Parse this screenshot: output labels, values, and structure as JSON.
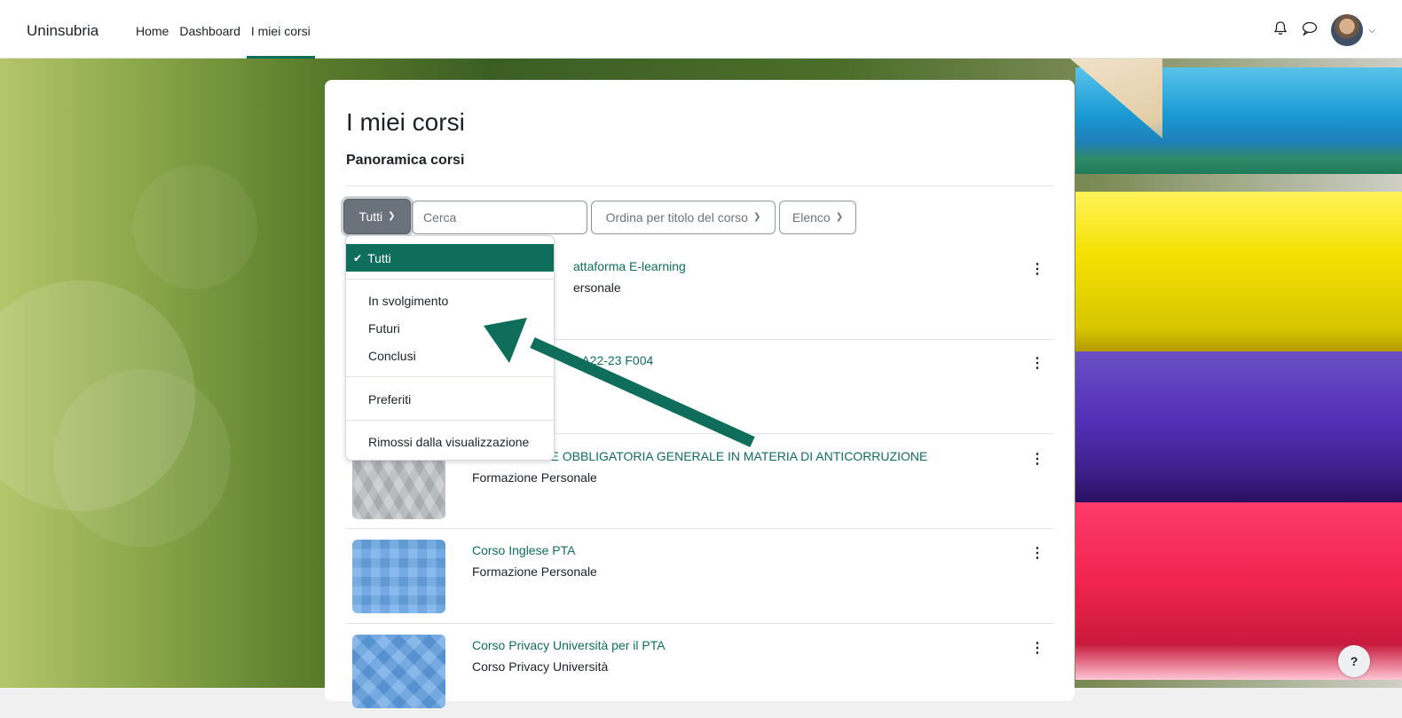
{
  "navbar": {
    "brand": "Uninsubria",
    "links": [
      "Home",
      "Dashboard",
      "I miei corsi"
    ],
    "active_link": "I miei corsi",
    "icons": [
      "bell-icon",
      "chat-icon",
      "avatar",
      "chevron-down-icon"
    ]
  },
  "page": {
    "title": "I miei corsi",
    "section": "Panoramica corsi"
  },
  "controls": {
    "filter_label": "Tutti",
    "search_placeholder": "Cerca",
    "sort_label": "Ordina per titolo del corso",
    "view_label": "Elenco"
  },
  "dropdown": {
    "selected": "Tutti",
    "items": [
      "Tutti",
      "In svolgimento",
      "Futuri",
      "Conclusi",
      "Preferiti",
      "Rimossi dalla visualizzazione"
    ]
  },
  "courses": [
    {
      "name_visible": "attaforma E-learning",
      "category_visible": "ersonale",
      "thumb": "hidden"
    },
    {
      "name_visible": "AA22-23 F004",
      "category_visible": "",
      "thumb": "hidden"
    },
    {
      "name_visible": "RMAZIONE OBBLIGATORIA GENERALE IN MATERIA DI ANTICORRUZIONE",
      "category_visible": "Formazione Personale",
      "thumb": "gray-diamonds"
    },
    {
      "name_visible": "Corso Inglese PTA",
      "category_visible": "Formazione Personale",
      "thumb": "blue-squares"
    },
    {
      "name_visible": "Corso Privacy Università per il PTA",
      "category_visible": "Corso Privacy Università",
      "thumb": "blue-diamonds"
    }
  ],
  "colors": {
    "accent": "#0f6e5b",
    "filter_button": "#6a737b",
    "arrow": "#0f6e5b"
  },
  "help_label": "?"
}
